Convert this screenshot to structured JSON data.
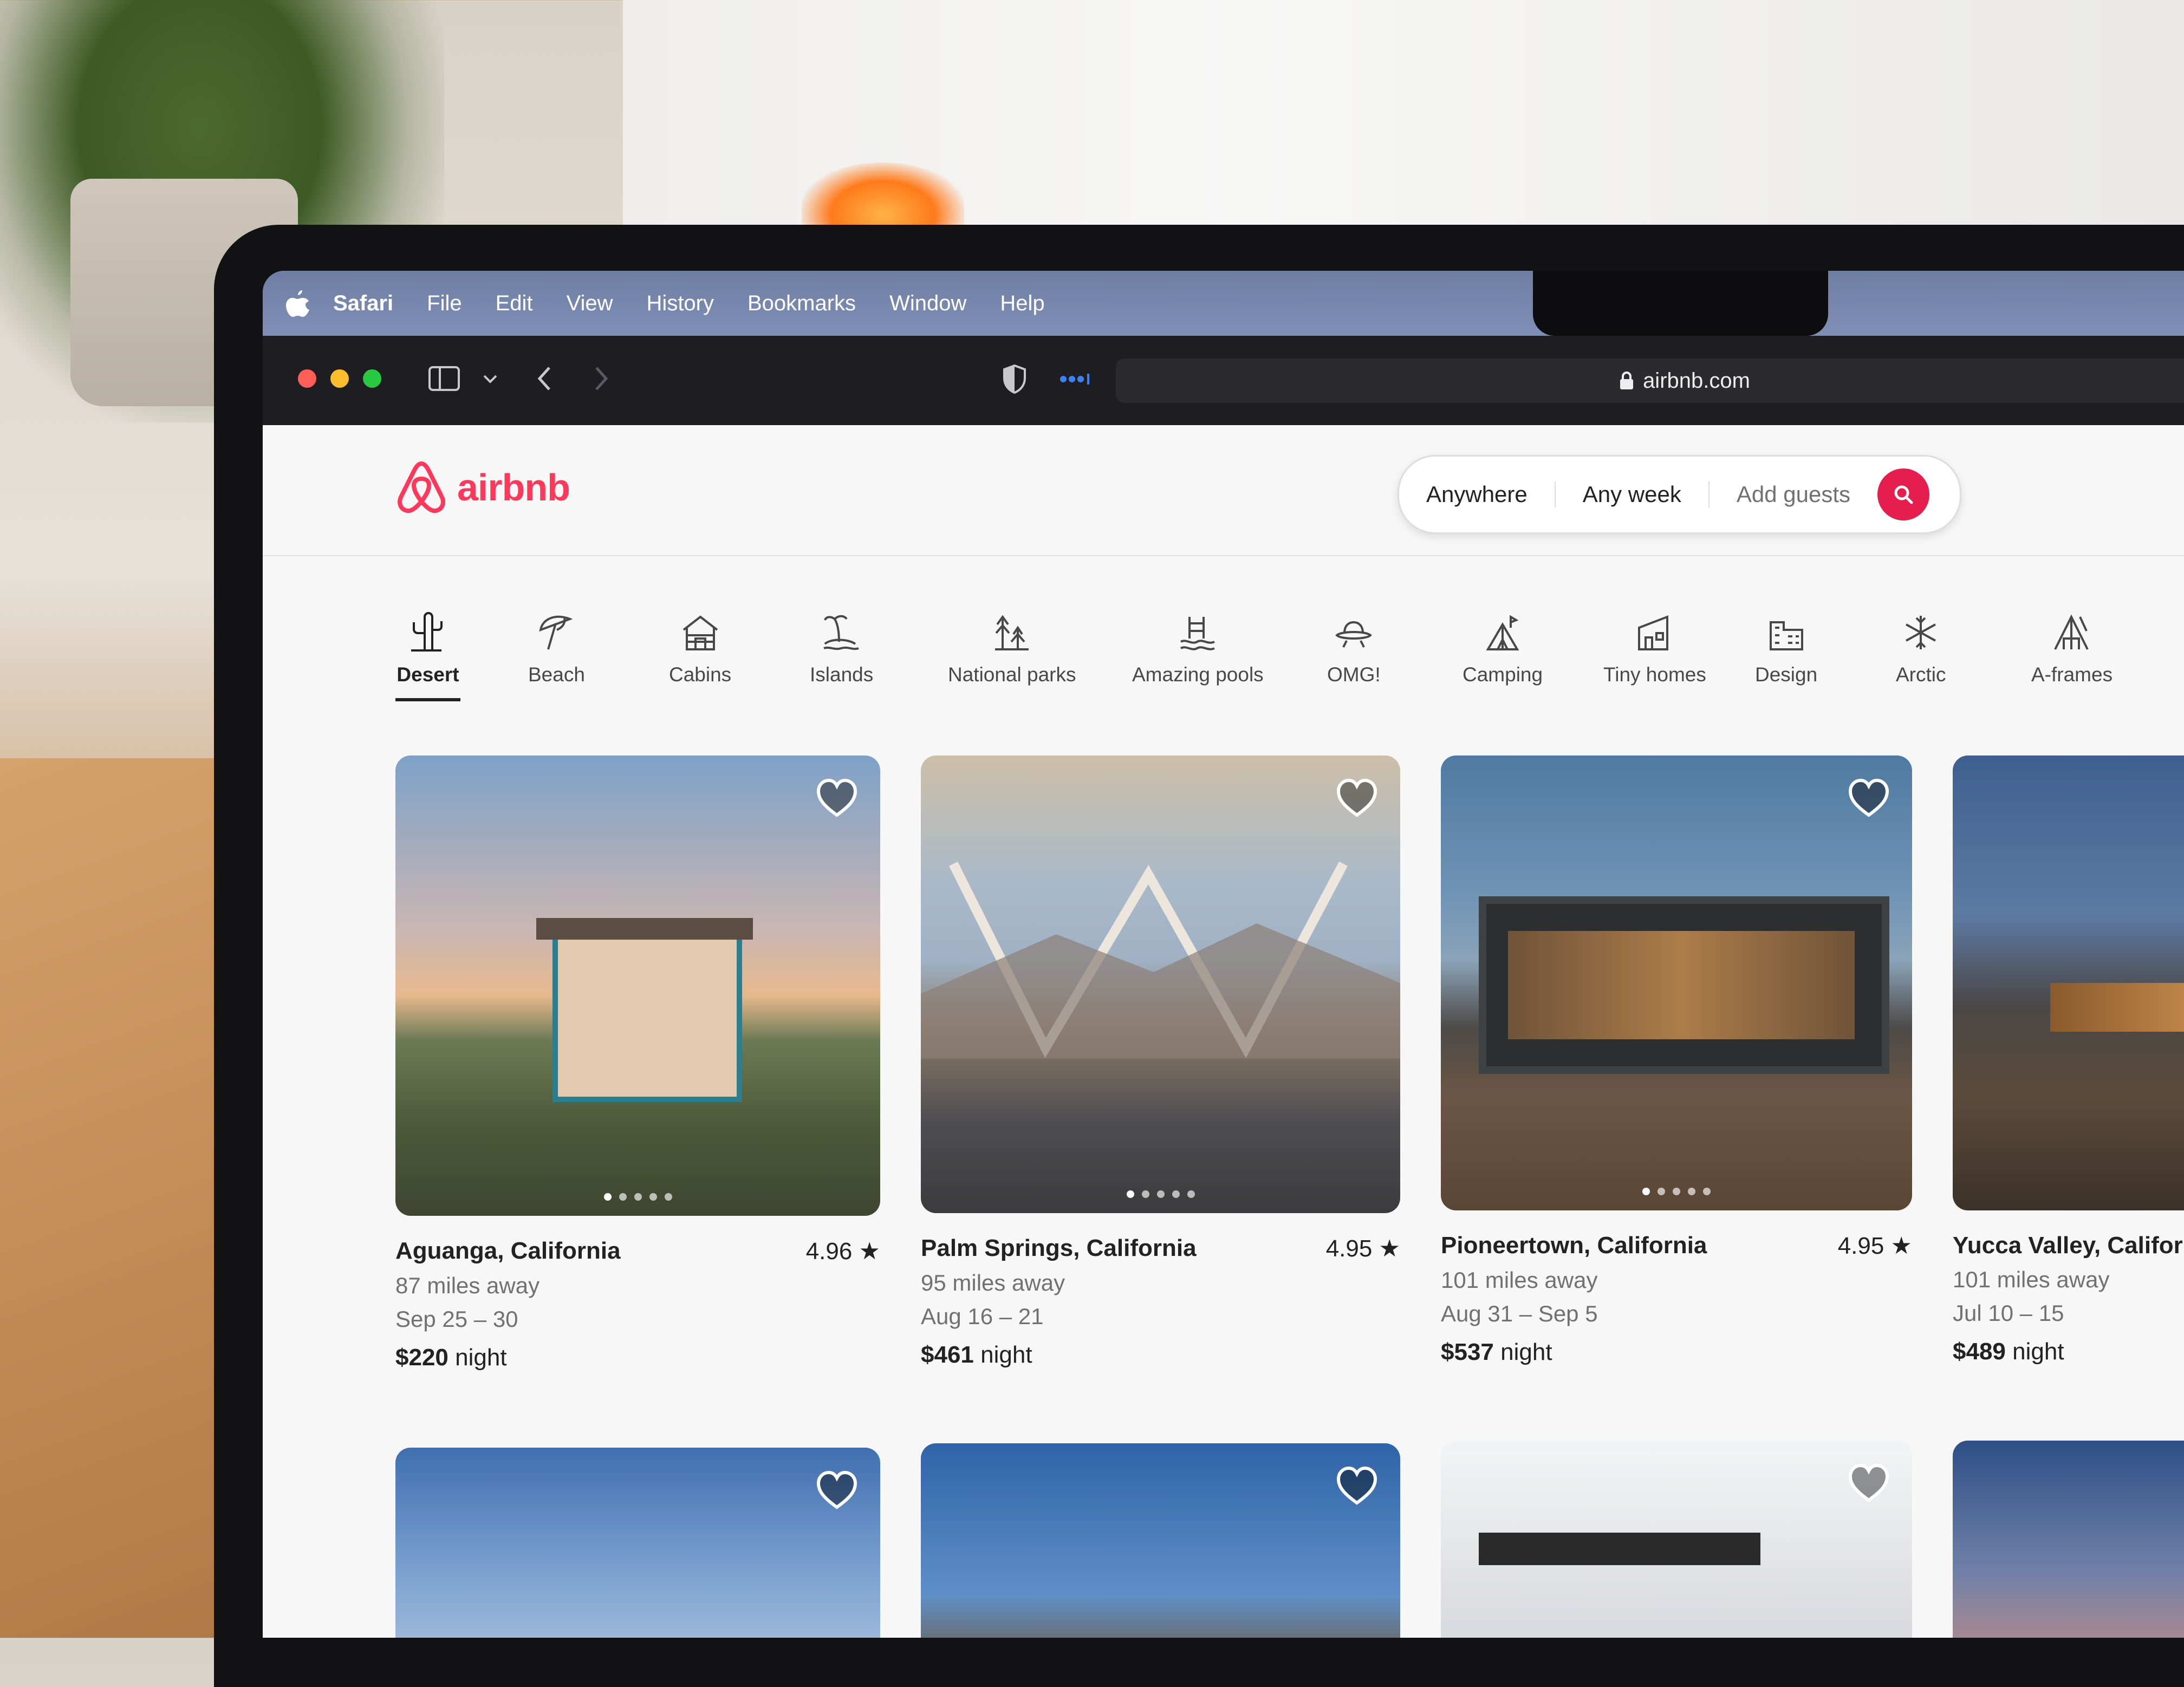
{
  "menubar": {
    "items": [
      "Safari",
      "File",
      "Edit",
      "View",
      "History",
      "Bookmarks",
      "Window",
      "Help"
    ]
  },
  "toolbar": {
    "address": "airbnb.com"
  },
  "brand": {
    "logo_text": "airbnb",
    "accent": "#ff385c"
  },
  "search": {
    "where": "Anywhere",
    "when": "Any week",
    "who": "Add guests"
  },
  "categories": [
    {
      "label": "Desert",
      "icon": "cactus-icon",
      "active": true
    },
    {
      "label": "Beach",
      "icon": "umbrella-icon"
    },
    {
      "label": "Cabins",
      "icon": "cabin-icon"
    },
    {
      "label": "Islands",
      "icon": "island-icon"
    },
    {
      "label": "National parks",
      "icon": "trees-icon"
    },
    {
      "label": "Amazing pools",
      "icon": "pool-icon"
    },
    {
      "label": "OMG!",
      "icon": "ufo-icon"
    },
    {
      "label": "Camping",
      "icon": "tent-icon"
    },
    {
      "label": "Tiny homes",
      "icon": "tiny-home-icon"
    },
    {
      "label": "Design",
      "icon": "design-building-icon"
    },
    {
      "label": "Arctic",
      "icon": "snowflake-icon"
    },
    {
      "label": "A-frames",
      "icon": "a-frame-icon"
    }
  ],
  "listings": [
    {
      "place": "Aguanga, California",
      "rating": "4.96 ★",
      "distance": "87 miles away",
      "dates": "Sep 25 – 30",
      "price": "$220",
      "price_unit": "night"
    },
    {
      "place": "Palm Springs, California",
      "rating": "4.95 ★",
      "distance": "95 miles away",
      "dates": "Aug 16 – 21",
      "price": "$461",
      "price_unit": "night"
    },
    {
      "place": "Pioneertown, California",
      "rating": "4.95 ★",
      "distance": "101 miles away",
      "dates": "Aug 31 – Sep 5",
      "price": "$537",
      "price_unit": "night"
    },
    {
      "place": "Yucca Valley, Californ",
      "rating": "",
      "distance": "101 miles away",
      "dates": "Jul 10 – 15",
      "price": "$489",
      "price_unit": "night"
    }
  ]
}
